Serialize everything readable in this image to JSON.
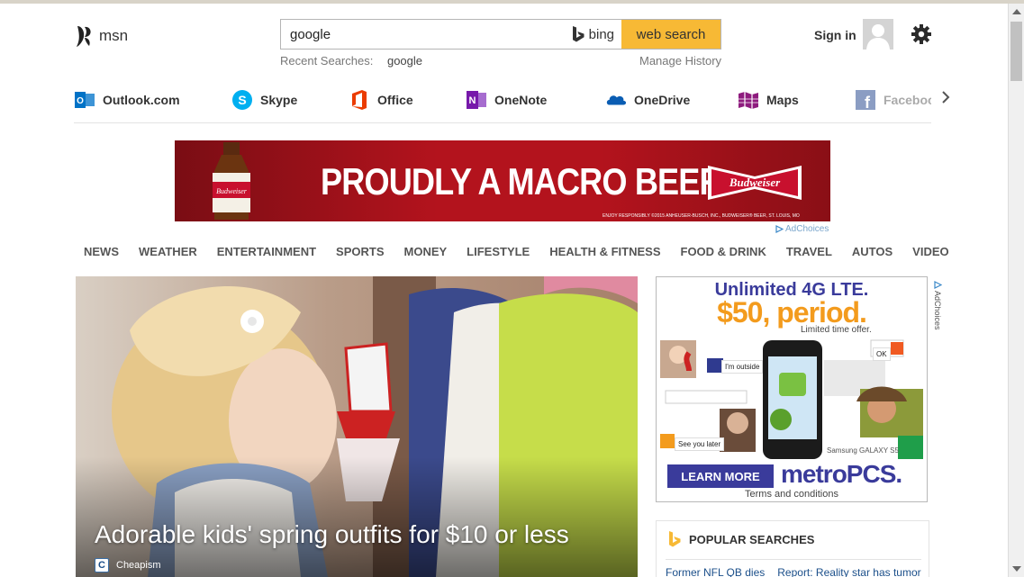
{
  "header": {
    "logo_text": "msn",
    "search_value": "google",
    "bing_label": "bing",
    "search_button": "web search",
    "recent_label": "Recent Searches:",
    "recent_term": "google",
    "manage_history": "Manage History",
    "sign_in": "Sign in"
  },
  "apps": [
    {
      "label": "Outlook.com",
      "icon": "outlook-icon",
      "color": "#0072c6"
    },
    {
      "label": "Skype",
      "icon": "skype-icon",
      "color": "#00aff0"
    },
    {
      "label": "Office",
      "icon": "office-icon",
      "color": "#eb3c00"
    },
    {
      "label": "OneNote",
      "icon": "onenote-icon",
      "color": "#7719aa"
    },
    {
      "label": "OneDrive",
      "icon": "onedrive-icon",
      "color": "#0a5db3"
    },
    {
      "label": "Maps",
      "icon": "maps-icon",
      "color": "#8e1b7e"
    },
    {
      "label": "Faceboo",
      "icon": "facebook-icon",
      "color": "#3b5998"
    }
  ],
  "banner_ad": {
    "headline": "PROUDLY A MACRO BEER",
    "brand": "Budweiser",
    "fine_print": "ENJOY RESPONSIBLY ©2015 ANHEUSER-BUSCH, INC., BUDWEISER® BEER, ST. LOUIS, MO",
    "adchoices": "AdChoices"
  },
  "categories": [
    "NEWS",
    "WEATHER",
    "ENTERTAINMENT",
    "SPORTS",
    "MONEY",
    "LIFESTYLE",
    "HEALTH & FITNESS",
    "FOOD & DRINK",
    "TRAVEL",
    "AUTOS",
    "VIDEO"
  ],
  "hero": {
    "title": "Adorable kids' spring outfits for $10 or less",
    "source": "Cheapism",
    "source_icon_letter": "C"
  },
  "side_ad": {
    "headline": "Unlimited 4G LTE.",
    "price": "$50, period.",
    "limited": "Limited time offer.",
    "notes": [
      "I'm outside",
      "See you later",
      "OK"
    ],
    "phone": "Samsung GALAXY S5",
    "cta": "LEARN MORE",
    "brand": "metroPCS.",
    "terms": "Terms and conditions",
    "adchoices": "AdChoices"
  },
  "popular": {
    "title": "POPULAR SEARCHES",
    "links": [
      "Former NFL QB dies",
      "Report: Reality star has tumor"
    ]
  },
  "colors": {
    "accent": "#f7b935",
    "brand_blue": "#3a3b9b",
    "ad_orange": "#f39b1d"
  }
}
